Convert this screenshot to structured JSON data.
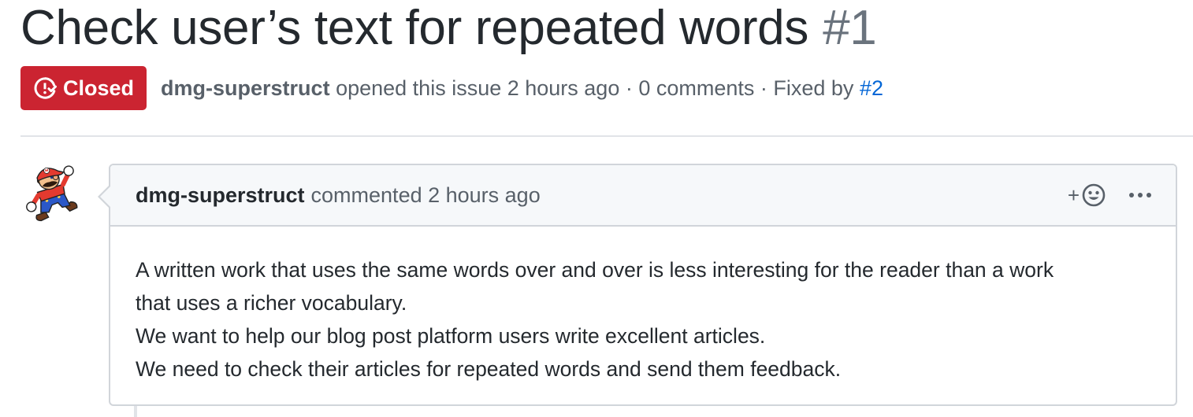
{
  "issue": {
    "title": "Check user’s text for repeated words",
    "number": "#1",
    "state": "Closed",
    "author": "dmg-superstruct",
    "opened_text": "opened this issue 2 hours ago · 0 comments · Fixed by",
    "fixed_by": "#2",
    "state_color": "#cb2431"
  },
  "comment": {
    "author": "dmg-superstruct",
    "action": "commented 2 hours ago",
    "reaction_icon": "smiley-icon",
    "more_icon": "kebab-horizontal-icon",
    "lines": [
      "A written work that uses the same words over and over is less interesting for the reader than a work",
      "that uses a richer vocabulary.",
      "We want to help our blog post platform users write excellent articles.",
      "We need to check their articles for repeated words and send them feedback."
    ]
  },
  "colors": {
    "link": "#0366d6",
    "muted_text": "#586069",
    "header_bg": "#f6f8fa"
  }
}
